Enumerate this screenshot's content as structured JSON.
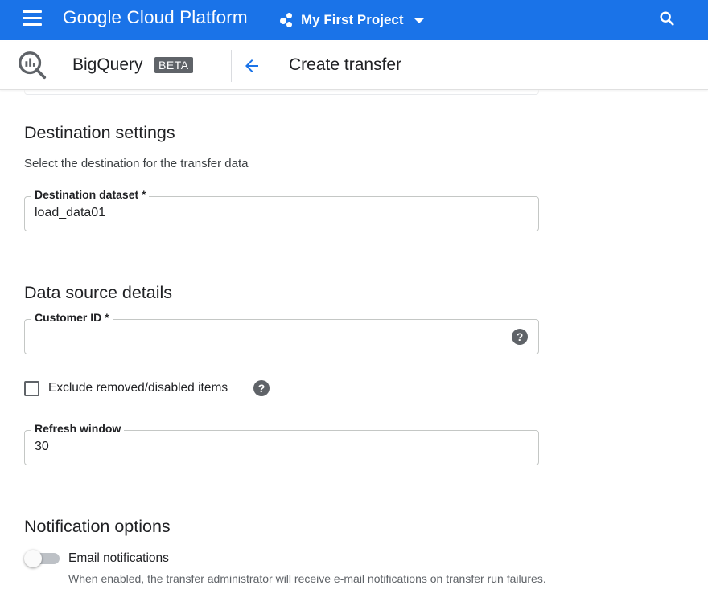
{
  "topbar": {
    "brand": "Google Cloud Platform",
    "project": "My First Project",
    "icons": [
      "menu-icon",
      "project-icon",
      "dropdown-caret-icon",
      "search-icon"
    ],
    "color": "#1a73e8"
  },
  "header": {
    "product": "BigQuery",
    "badge": "BETA",
    "page_title": "Create transfer",
    "icons": [
      "bigquery-logo-icon",
      "back-arrow-icon"
    ]
  },
  "destination": {
    "heading": "Destination settings",
    "description": "Select the destination for the transfer data",
    "dataset_label": "Destination dataset *",
    "dataset_value": "load_data01"
  },
  "data_source": {
    "heading": "Data source details",
    "customer_id_label": "Customer ID *",
    "customer_id_value": "",
    "help_glyph": "?",
    "exclude_label": "Exclude removed/disabled items",
    "exclude_checked": false,
    "refresh_label": "Refresh window",
    "refresh_value": "30"
  },
  "notifications": {
    "heading": "Notification options",
    "email_label": "Email notifications",
    "email_enabled": false,
    "email_help": "When enabled, the transfer administrator will receive e-mail notifications on transfer run failures."
  }
}
